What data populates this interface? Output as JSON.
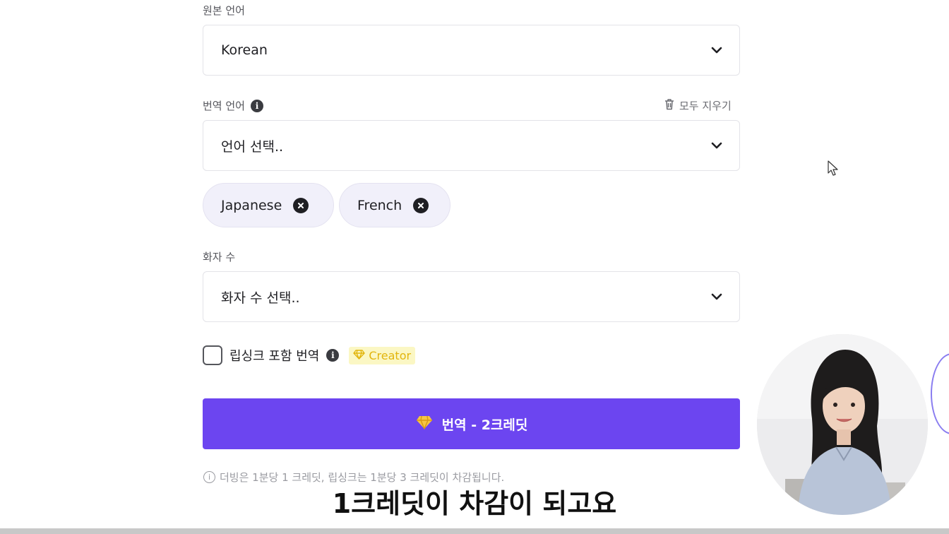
{
  "source_language": {
    "label": "원본 언어",
    "value": "Korean"
  },
  "target_language": {
    "label": "번역 언어",
    "clear_all": "모두 지우기",
    "placeholder": "언어 선택..",
    "selected": [
      "Japanese",
      "French"
    ]
  },
  "speakers": {
    "label": "화자 수",
    "placeholder": "화자 수 선택.."
  },
  "lipsync": {
    "label": "립싱크 포함 번역",
    "badge": "Creator",
    "checked": false
  },
  "translate_button": {
    "label": "번역 - 2크레딧"
  },
  "footnote": "더빙은 1분당 1 크레딧, 립싱크는 1분당 3 크레딧이 차감됩니다.",
  "subtitle": "1크레딧이 차감이 되고요",
  "colors": {
    "accent": "#6c45f0",
    "badge_bg": "#fbf7c4",
    "badge_text": "#e2b50d",
    "chip_bg": "#f1f0fa"
  },
  "icons": [
    "chevron-down-icon",
    "info-icon",
    "trash-icon",
    "close-circle-icon",
    "diamond-icon",
    "mouse-cursor-icon"
  ]
}
